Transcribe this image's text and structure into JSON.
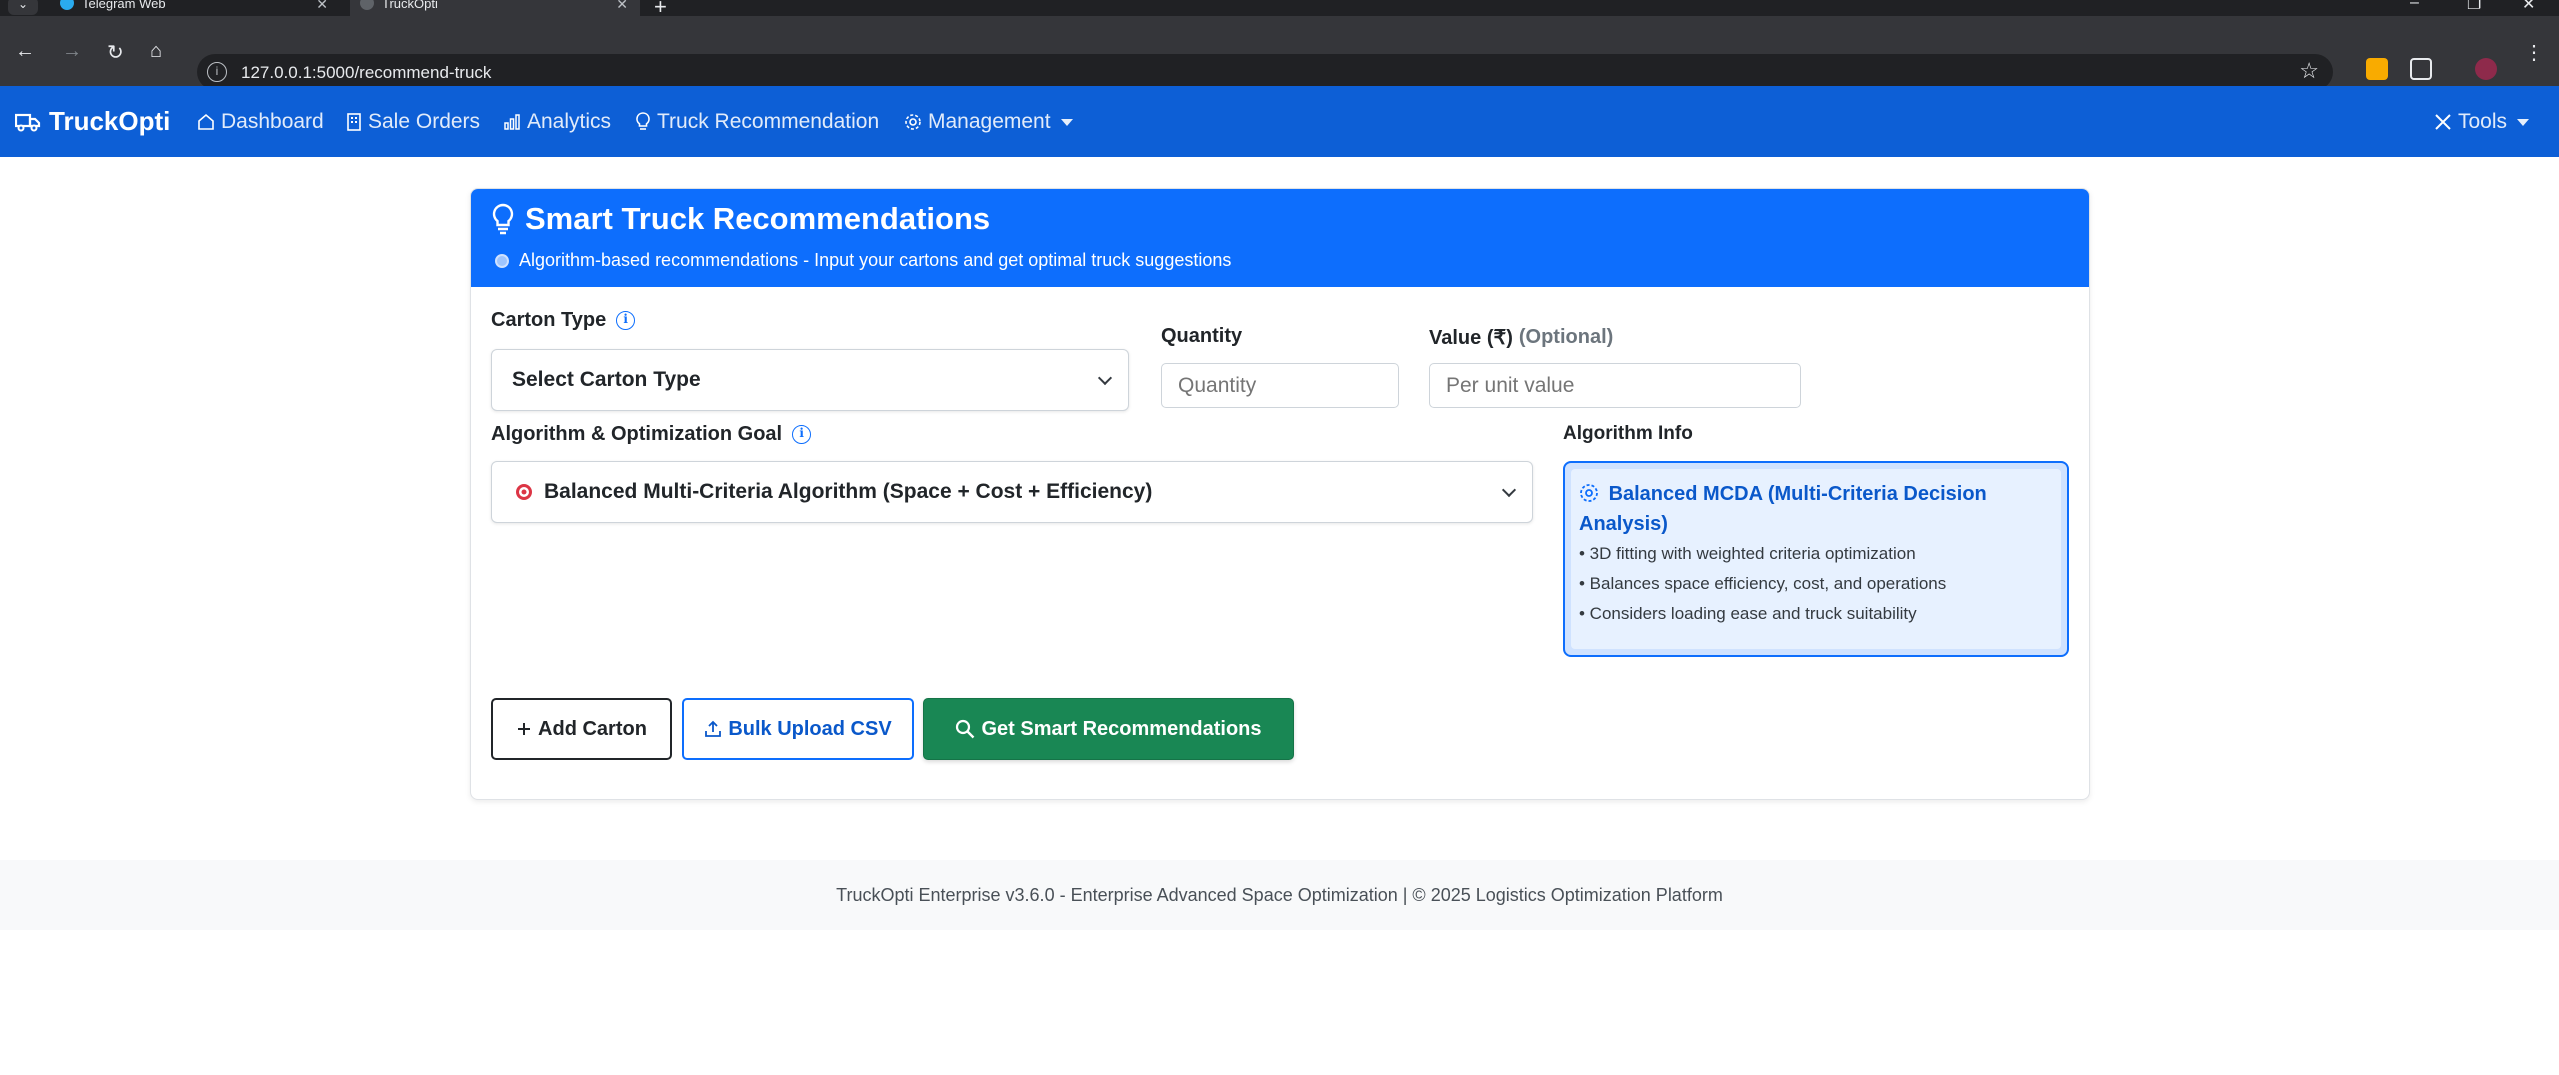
{
  "browser": {
    "tabs": [
      {
        "title": "Telegram Web",
        "active": false
      },
      {
        "title": "TruckOpti",
        "active": true
      }
    ],
    "url": "127.0.0.1:5000/recommend-truck"
  },
  "navbar": {
    "brand": "TruckOpti",
    "items": [
      "Dashboard",
      "Sale Orders",
      "Analytics",
      "Truck Recommendation",
      "Management"
    ],
    "tools": "Tools"
  },
  "card": {
    "title": "Smart Truck Recommendations",
    "subtitle": "Algorithm-based recommendations - Input your cartons and get optimal truck suggestions",
    "carton_type_label": "Carton Type",
    "carton_type_value": "Select Carton Type",
    "quantity_label": "Quantity",
    "quantity_placeholder": "Quantity",
    "value_label": "Value (₹)",
    "value_optional": "(Optional)",
    "value_placeholder": "Per unit value",
    "algorithm_label": "Algorithm & Optimization Goal",
    "algorithm_value": "Balanced Multi-Criteria Algorithm (Space + Cost + Efficiency)",
    "algorithm_info_label": "Algorithm Info",
    "algorithm_info": {
      "title": "Balanced MCDA (Multi-Criteria Decision Analysis)",
      "points": [
        "• 3D fitting with weighted criteria optimization",
        "• Balances space efficiency, cost, and operations",
        "• Considers loading ease and truck suitability"
      ]
    },
    "buttons": {
      "add": "Add Carton",
      "bulk": "Bulk Upload CSV",
      "smart": "Get Smart Recommendations"
    }
  },
  "footer": "TruckOpti Enterprise v3.6.0 - Enterprise Advanced Space Optimization | © 2025 Logistics Optimization Platform",
  "colors": {
    "navbar": "#0d5fd6",
    "header": "#0d6efd",
    "success": "#198754"
  }
}
